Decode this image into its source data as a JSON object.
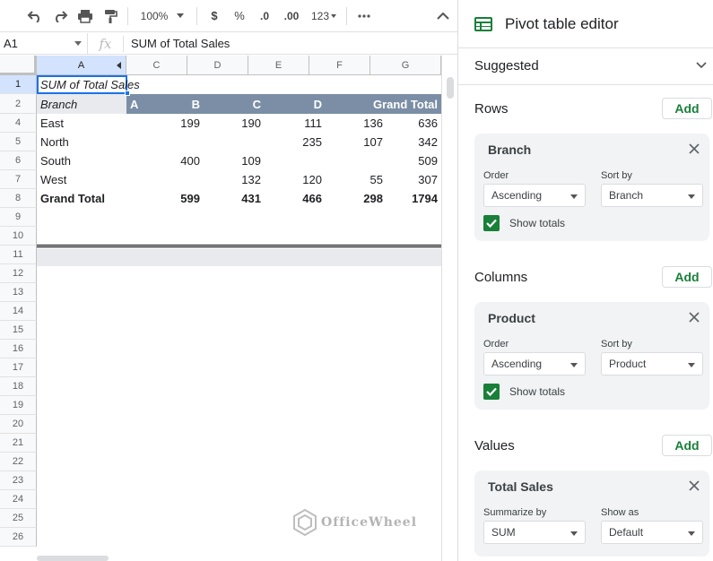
{
  "toolbar": {
    "zoom": "100%",
    "currency": "$",
    "percent": "%",
    "dec_decrease": ".0",
    "dec_increase": ".00",
    "format_more": "123"
  },
  "formula_bar": {
    "cell_ref": "A1",
    "fx": "fx",
    "content": "SUM of Total Sales"
  },
  "grid": {
    "columns": [
      "A",
      "C",
      "D",
      "E",
      "F",
      "G"
    ],
    "rows": [
      "1",
      "2",
      "4",
      "5",
      "6",
      "7",
      "8",
      "9",
      "10",
      "11",
      "12",
      "13",
      "14",
      "15",
      "16",
      "17",
      "18",
      "19",
      "20",
      "21",
      "22",
      "23",
      "24",
      "25",
      "26"
    ],
    "pivot": {
      "title": "SUM of Total Sales",
      "header_branch": "Branch",
      "col_headers": [
        "A",
        "B",
        "C",
        "D",
        "Grand Total"
      ],
      "data_rows": [
        {
          "label": "East",
          "values": [
            "199",
            "190",
            "111",
            "136",
            "636"
          ]
        },
        {
          "label": "North",
          "values": [
            "",
            "",
            "235",
            "107",
            "342"
          ]
        },
        {
          "label": "South",
          "values": [
            "400",
            "109",
            "",
            "",
            "509"
          ]
        },
        {
          "label": "West",
          "values": [
            "",
            "132",
            "120",
            "55",
            "307"
          ]
        }
      ],
      "total_row": {
        "label": "Grand Total",
        "values": [
          "599",
          "431",
          "466",
          "298",
          "1794"
        ]
      }
    }
  },
  "watermark": "OfficeWheel",
  "panel": {
    "title": "Pivot table editor",
    "suggested": "Suggested",
    "sections": [
      {
        "label": "Rows",
        "add": "Add",
        "card_title": "Branch",
        "order_label": "Order",
        "order_value": "Ascending",
        "sortby_label": "Sort by",
        "sortby_value": "Branch",
        "checkbox_label": "Show totals"
      },
      {
        "label": "Columns",
        "add": "Add",
        "card_title": "Product",
        "order_label": "Order",
        "order_value": "Ascending",
        "sortby_label": "Sort by",
        "sortby_value": "Product",
        "checkbox_label": "Show totals"
      }
    ],
    "values": {
      "label": "Values",
      "add": "Add",
      "card_title": "Total Sales",
      "summarize_label": "Summarize by",
      "summarize_value": "SUM",
      "showas_label": "Show as",
      "showas_value": "Default"
    }
  },
  "colors": {
    "accent_green": "#188038",
    "pivot_header": "#7b8ea6",
    "selection": "#d3e3fd"
  }
}
